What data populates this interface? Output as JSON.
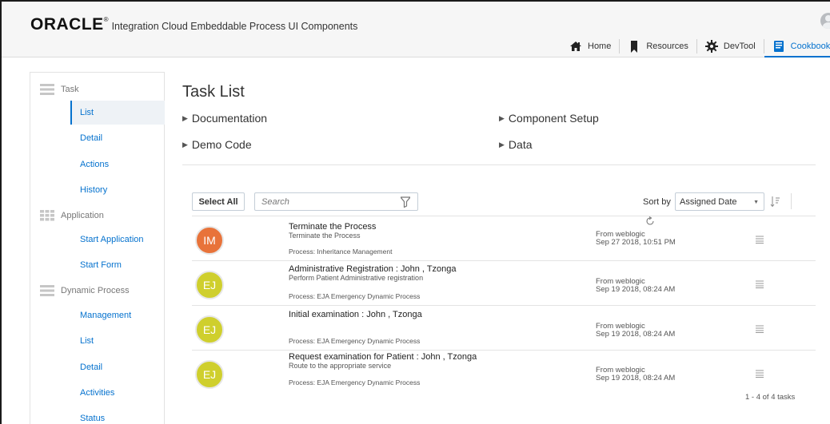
{
  "header": {
    "logo": "ORACLE",
    "logo_reg": "®",
    "title": "Integration Cloud Embeddable Process UI Components"
  },
  "topnav": [
    {
      "label": "Home",
      "icon": "home-icon"
    },
    {
      "label": "Resources",
      "icon": "bookmark-icon"
    },
    {
      "label": "DevTool",
      "icon": "gear-icon"
    },
    {
      "label": "Cookbook",
      "icon": "book-icon",
      "active": true
    }
  ],
  "sidebar": {
    "groups": [
      {
        "label": "Task",
        "items": [
          "List",
          "Detail",
          "Actions",
          "History"
        ]
      },
      {
        "label": "Application",
        "items": [
          "Start Application",
          "Start Form"
        ]
      },
      {
        "label": "Dynamic Process",
        "items": [
          "Management",
          "List",
          "Detail",
          "Activities",
          "Status"
        ]
      }
    ],
    "active_item": "List"
  },
  "main": {
    "title": "Task List",
    "sections": [
      "Documentation",
      "Component Setup",
      "Demo Code",
      "Data"
    ]
  },
  "toolbar": {
    "select_all_label": "Select All",
    "search_placeholder": "Search",
    "sort_label": "Sort by",
    "sort_value": "Assigned Date"
  },
  "tasks": [
    {
      "initials": "IM",
      "color": "#e8733a",
      "title": "Terminate the Process",
      "subtitle": "Terminate the Process",
      "process": "Process: Inheritance Management",
      "from": "From weblogic",
      "date": "Sep 27 2018, 10:51 PM"
    },
    {
      "initials": "EJ",
      "color": "#cfcf2d",
      "title": "Administrative Registration : John , Tzonga",
      "subtitle": "Perform Patient Administrative registration",
      "process": "Process: EJA Emergency Dynamic Process",
      "from": "From weblogic",
      "date": "Sep 19 2018, 08:24 AM"
    },
    {
      "initials": "EJ",
      "color": "#cfcf2d",
      "title": "Initial examination : John , Tzonga",
      "subtitle": "",
      "process": "Process: EJA Emergency Dynamic Process",
      "from": "From weblogic",
      "date": "Sep 19 2018, 08:24 AM"
    },
    {
      "initials": "EJ",
      "color": "#cfcf2d",
      "title": "Request examination for Patient : John , Tzonga",
      "subtitle": "Route to the appropriate service",
      "process": "Process: EJA Emergency Dynamic Process",
      "from": "From weblogic",
      "date": "Sep 19 2018, 08:24 AM"
    }
  ],
  "pagination": "1 - 4 of 4 tasks",
  "colors": {
    "link": "#0572ce",
    "im_avatar": "#e8733a",
    "ej_avatar": "#cfcf2d"
  }
}
